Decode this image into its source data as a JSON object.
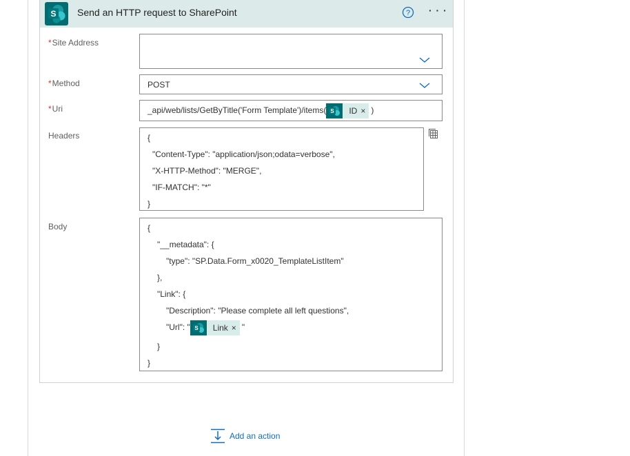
{
  "action": {
    "title": "Send an HTTP request to SharePoint",
    "help_icon": "question-circle-icon",
    "more_icon": "more-options-icon",
    "brand_color": "#036c70"
  },
  "fields": {
    "site_address": {
      "label": "Site Address",
      "required_mark": "*",
      "value": ""
    },
    "method": {
      "label": "Method",
      "required_mark": "*",
      "value": "POST"
    },
    "uri": {
      "label": "Uri",
      "required_mark": "*",
      "prefix": "_api/web/lists/GetByTitle('Form Template')/items(",
      "token": "ID",
      "suffix": ")"
    },
    "headers": {
      "label": "Headers",
      "lines": [
        "{",
        "\"Content-Type\": \"application/json;odata=verbose\",",
        "\"X-HTTP-Method\": \"MERGE\",",
        "\"IF-MATCH\": \"*\"",
        "}"
      ]
    },
    "body": {
      "label": "Body",
      "lines": [
        "{",
        "\"__metadata\": {",
        "\"type\": \"SP.Data.Form_x0020_TemplateListItem\"",
        "},",
        "\"Link\": {",
        "\"Description\": \"Please complete all left questions\",",
        "\"Url\": \"",
        "}",
        "}"
      ],
      "url_token": "Link",
      "url_suffix": "\""
    }
  },
  "token_close": "×",
  "add_action": {
    "label": "Add an action"
  }
}
